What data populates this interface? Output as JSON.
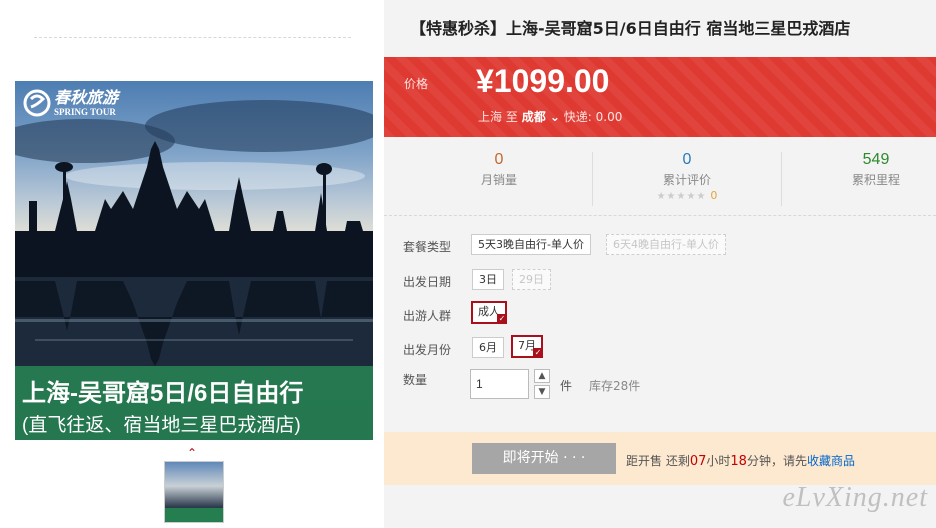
{
  "gallery": {
    "brand_cn": "春秋旅游",
    "brand_en": "SPRING TOUR",
    "image_title": "上海-吴哥窟5日/6日自由行",
    "image_subtitle": "(直飞往返、宿当地三星巴戎酒店)"
  },
  "product": {
    "title": "【特惠秒杀】上海-吴哥窟5日/6日自由行 宿当地三星巴戎酒店"
  },
  "price": {
    "label": "价格",
    "value": "¥1099.00",
    "from_city": "上海",
    "to_word": "至",
    "to_city": "成都",
    "shipping": "快递: 0.00"
  },
  "stats": {
    "monthly_sales": {
      "value": "0",
      "label": "月销量"
    },
    "reviews": {
      "value": "0",
      "label": "累计评价",
      "stars": "★★★★★",
      "star_count": "0"
    },
    "mileage": {
      "value": "549",
      "label": "累积里程"
    }
  },
  "options": {
    "package": {
      "label": "套餐类型",
      "items": [
        "5天3晚自由行-单人价",
        "6天4晚自由行-单人价"
      ]
    },
    "date": {
      "label": "出发日期",
      "items": [
        "3日",
        "29日"
      ]
    },
    "traveler": {
      "label": "出游人群",
      "items": [
        "成人"
      ]
    },
    "month": {
      "label": "出发月份",
      "items": [
        "6月",
        "7月"
      ]
    },
    "quantity": {
      "label": "数量",
      "value": "1",
      "unit": "件",
      "stock": "库存28件"
    }
  },
  "cta": {
    "button": "即将开始 · · ·",
    "prefix": "距开售 还剩",
    "hours": "07",
    "hours_unit": "小时",
    "minutes": "18",
    "minutes_unit": "分钟，请先",
    "favorite": "收藏商品"
  },
  "watermark": "eLvXing.net",
  "colors": {
    "price_bar": "#de3a32",
    "selected_border": "#a8111c",
    "cta_bg": "#fde9cf",
    "brand_green": "#257e50"
  }
}
